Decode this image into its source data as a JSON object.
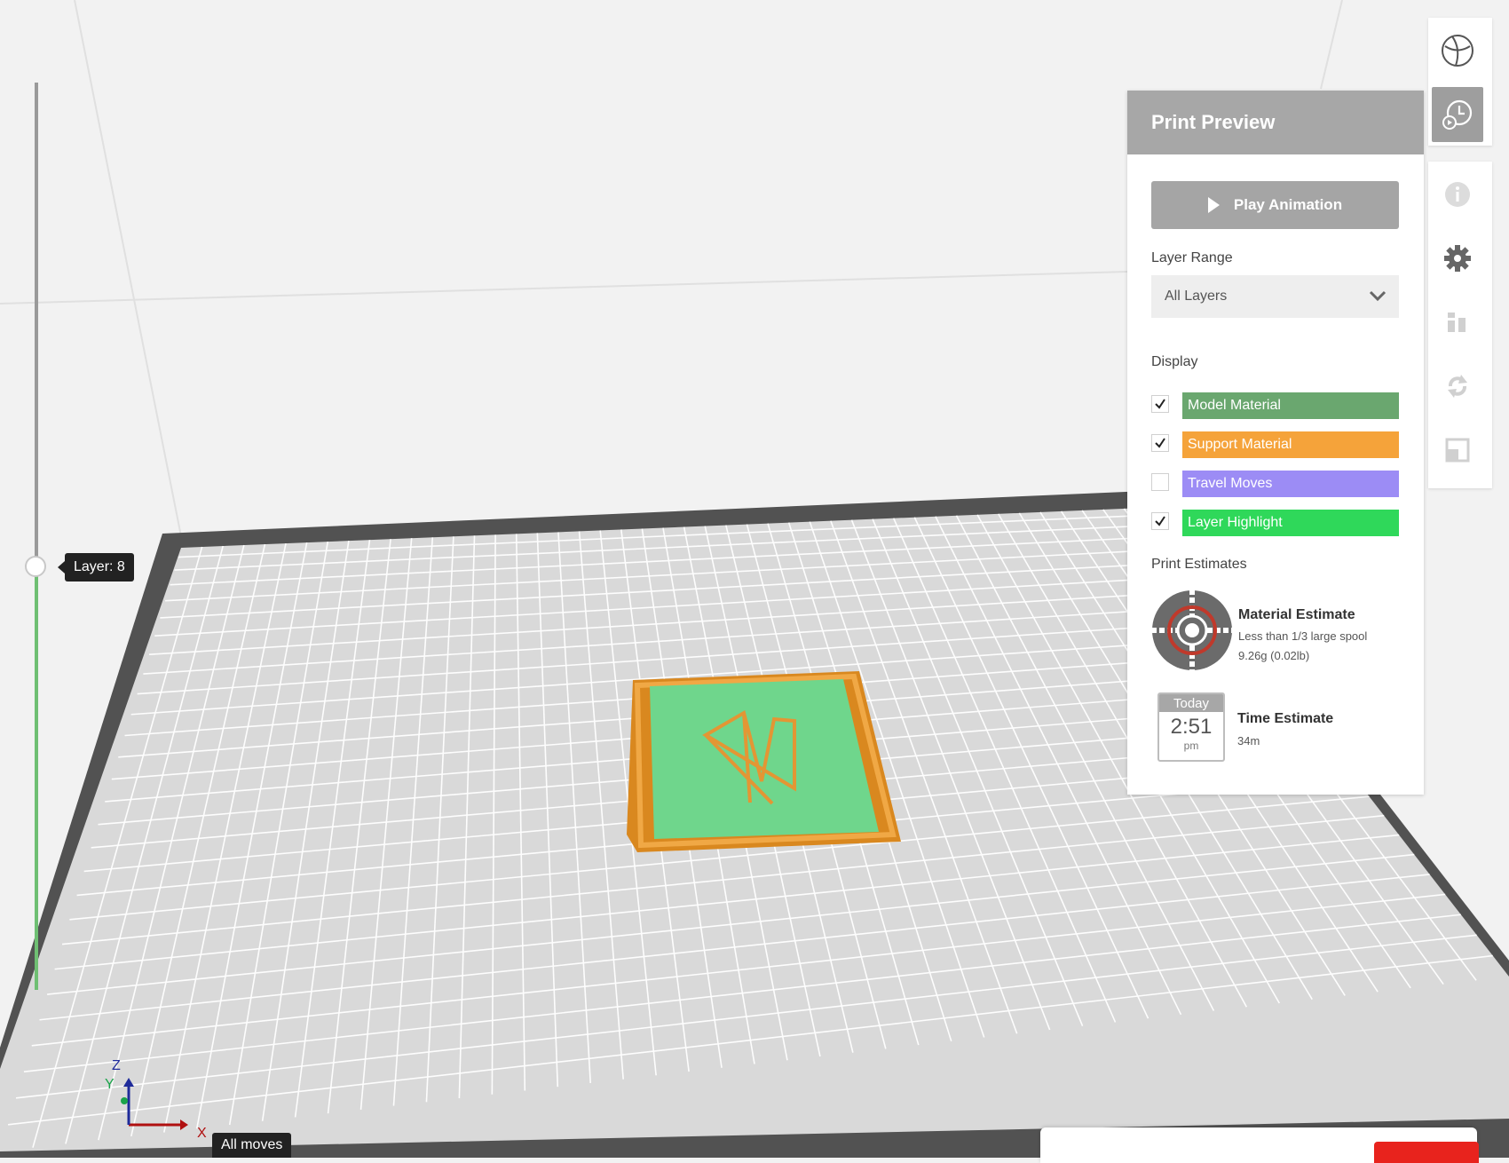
{
  "viewport": {
    "layer_indicator": "Layer: 8",
    "axis": {
      "x": "X",
      "y": "Y",
      "z": "Z"
    },
    "moves_label": "All moves"
  },
  "panel": {
    "title": "Print Preview",
    "play_label": "Play Animation",
    "layer_range_label": "Layer Range",
    "layer_range_value": "All Layers",
    "display_label": "Display",
    "display_items": [
      {
        "label": "Model Material",
        "checked": true,
        "color": "#6aa76f"
      },
      {
        "label": "Support Material",
        "checked": true,
        "color": "#f5a33a"
      },
      {
        "label": "Travel Moves",
        "checked": false,
        "color": "#9c8cf5"
      },
      {
        "label": "Layer Highlight",
        "checked": true,
        "color": "#2fd85a"
      }
    ],
    "estimates_label": "Print Estimates",
    "material": {
      "title": "Material Estimate",
      "line1": "Less than 1/3 large spool",
      "line2": "9.26g (0.02lb)",
      "icon": "spool-icon"
    },
    "time": {
      "title": "Time Estimate",
      "line1": "34m",
      "cal_day": "Today",
      "cal_time": "2:51",
      "cal_ampm": "pm",
      "icon": "calendar-icon"
    }
  },
  "toolbar": {
    "items": [
      "view-cube-icon",
      "print-preview-icon",
      "info-icon",
      "gear-icon",
      "align-icon",
      "rotate-icon",
      "scale-icon"
    ]
  },
  "colors": {
    "accent_red": "#e8231d",
    "header_gray": "#a7a7a7",
    "plate_border": "#525252",
    "grid_fill": "#d9d9d9"
  }
}
